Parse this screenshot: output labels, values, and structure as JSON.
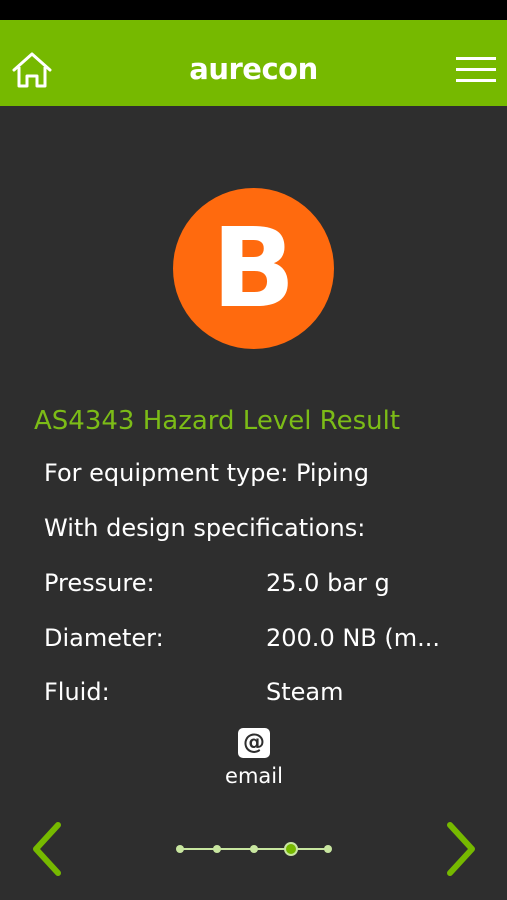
{
  "header": {
    "brand": "aurecon",
    "home_icon": "home-icon",
    "menu_icon": "hamburger-menu-icon",
    "bg_color": "#76b900"
  },
  "result": {
    "hazard_letter": "B",
    "badge_color": "#ff6a0e",
    "title": "AS4343 Hazard Level Result",
    "equipment_line": "For equipment type: Piping",
    "specs_heading": "With design specifications:",
    "specs": [
      {
        "label": "Pressure:",
        "value": "25.0 bar g"
      },
      {
        "label": "Diameter:",
        "value": "200.0 NB (m..."
      },
      {
        "label": "Fluid:",
        "value": "Steam"
      }
    ]
  },
  "actions": {
    "email_label": "email",
    "email_icon": "at-sign-icon"
  },
  "pager": {
    "total_pages": 5,
    "current_page": 4
  },
  "colors": {
    "accent_green": "#76b900",
    "background": "#2e2e2e"
  }
}
